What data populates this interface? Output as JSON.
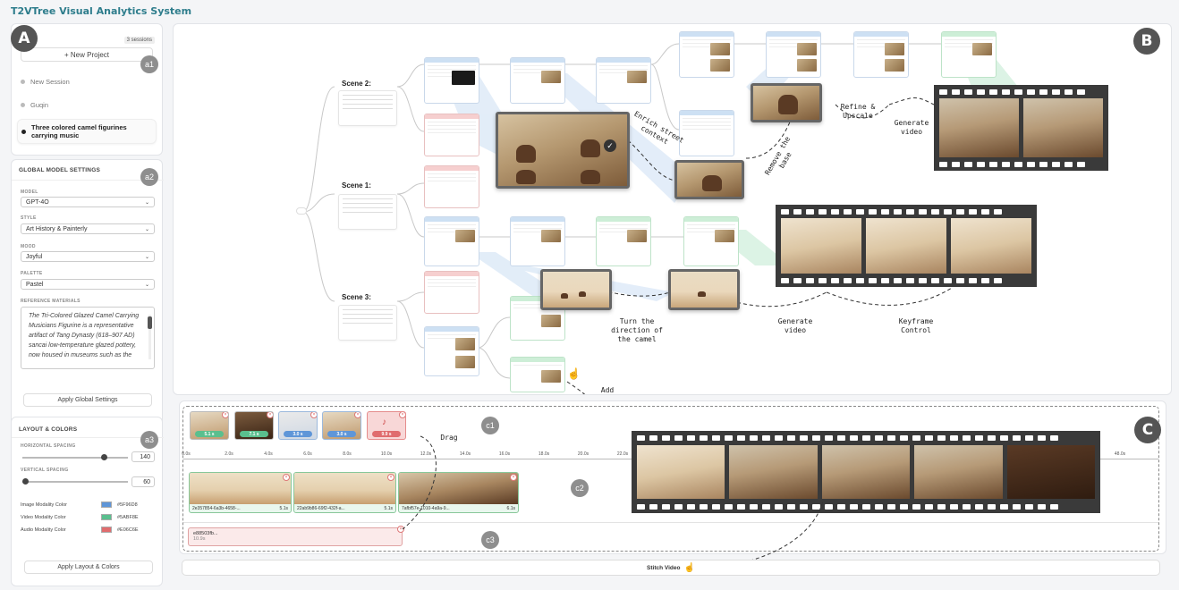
{
  "app": {
    "title": "T2VTree Visual Analytics System"
  },
  "badges": {
    "a": "A",
    "b": "B",
    "c": "C",
    "a1": "a1",
    "a2": "a2",
    "a3": "a3",
    "c1": "c1",
    "c2": "c2",
    "c3": "c3"
  },
  "sessions": {
    "count": "3 sessions",
    "new_project": "+ New Project",
    "items": [
      {
        "label": "New Session",
        "active": false
      },
      {
        "label": "Guqin",
        "active": false
      },
      {
        "label": "Three colored camel figurines carrying music",
        "active": true
      }
    ]
  },
  "global_settings": {
    "title": "GLOBAL MODEL SETTINGS",
    "model_label": "MODEL",
    "model_value": "GPT-4O",
    "style_label": "STYLE",
    "style_value": "Art History & Painterly",
    "mood_label": "MOOD",
    "mood_value": "Joyful",
    "palette_label": "PALETTE",
    "palette_value": "Pastel",
    "reference_label": "REFERENCE MATERIALS",
    "reference_text": "The Tri-Colored Glazed Camel Carrying Musicians Figurine is a representative artifact of Tang Dynasty (618–907 AD) sancai low-temperature glazed pottery, now housed in museums such as the",
    "apply_label": "Apply Global Settings"
  },
  "layout_colors": {
    "title": "LAYOUT & COLORS",
    "h_spacing_label": "HORIZONTAL SPACING",
    "h_spacing_value": "140",
    "h_spacing_level": 0.75,
    "v_spacing_label": "VERTICAL SPACING",
    "v_spacing_value": "60",
    "v_spacing_level": 0.0,
    "image_color_label": "Image Modality Color",
    "image_color": "#5F96D8",
    "video_color_label": "Video Modality Color",
    "video_color": "#5ABF8E",
    "audio_color_label": "Audio Modality Color",
    "audio_color": "#E06C6E",
    "apply_label": "Apply Layout & Colors"
  },
  "tree": {
    "scenes": [
      "Scene 2:",
      "Scene 1:",
      "Scene 3:"
    ],
    "annotations": {
      "enrich": "Enrich street context",
      "remove_base": "Remove the base",
      "refine": "Refine & Upscale",
      "generate_video_top": "Generate video",
      "turn_camel": "Turn the direction of the camel",
      "generate_video_mid": "Generate video",
      "keyframe": "Keyframe Control",
      "add": "Add",
      "drag": "Drag"
    }
  },
  "timeline": {
    "clips": [
      "5.1 s",
      "7.1 s",
      "3.0 s",
      "3.0 s",
      "9.9 s"
    ],
    "ruler": [
      "0.0s",
      "2.0s",
      "4.0s",
      "6.0s",
      "8.0s",
      "10.0s",
      "12.0s",
      "14.0s",
      "16.0s",
      "18.0s",
      "20.0s",
      "22.0s",
      "48.0s"
    ],
    "video_clips": [
      {
        "id": "2e357854-6a3b-4658-...",
        "dur": "5.1s"
      },
      {
        "id": "22ab9b86-69f2-432f-a...",
        "dur": "5.1s"
      },
      {
        "id": "7afbf57e-1010-4a9a-9...",
        "dur": "6.1s"
      }
    ],
    "audio_clip": {
      "id": "e88503fb...",
      "dur": "10.9s"
    },
    "stitch_label": "Stitch Video"
  },
  "colors": {
    "accent": "#2e7d8c",
    "image": "#5F96D8",
    "video": "#5ABF8E",
    "audio": "#E06C6E"
  }
}
